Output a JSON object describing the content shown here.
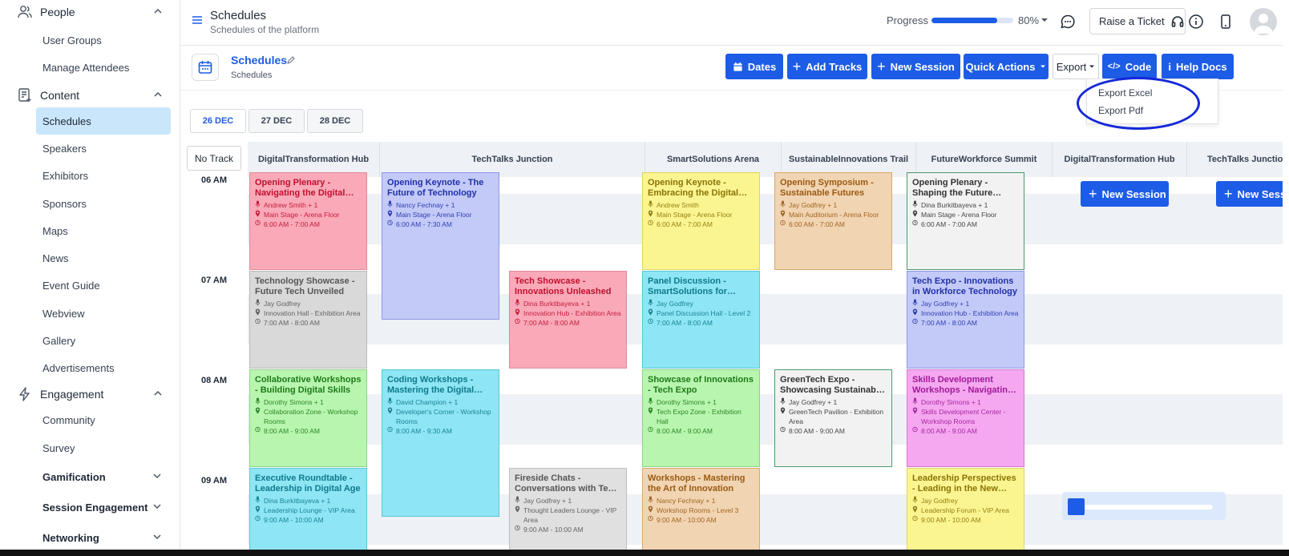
{
  "sidebar": {
    "groups": {
      "people": "People",
      "content": "Content",
      "engagement": "Engagement"
    },
    "people_items": [
      "User Groups",
      "Manage Attendees"
    ],
    "content_items": [
      "Schedules",
      "Speakers",
      "Exhibitors",
      "Sponsors",
      "Maps",
      "News",
      "Event Guide",
      "Webview",
      "Gallery",
      "Advertisements"
    ],
    "engagement_items": [
      "Community",
      "Survey"
    ],
    "subgroups": [
      "Gamification",
      "Session Engagement",
      "Networking"
    ]
  },
  "header": {
    "title": "Schedules",
    "subtitle": "Schedules of the platform",
    "progress_label": "Progress",
    "progress_value": 80,
    "progress_text": "80%",
    "ticket_label": "Raise a Ticket"
  },
  "page": {
    "title": "Schedules",
    "subtitle": "Schedules",
    "buttons": {
      "dates": "Dates",
      "add_tracks": "Add Tracks",
      "new_session": "New Session",
      "quick_actions": "Quick Actions",
      "export": "Export",
      "code": "Code",
      "help_docs": "Help Docs"
    },
    "export_menu": [
      "Export Excel",
      "Export Pdf"
    ]
  },
  "dates": [
    "26 DEC",
    "27 DEC",
    "28 DEC"
  ],
  "grid": {
    "no_track": "No Track",
    "tracks": [
      "DigitalTransformation Hub",
      "TechTalks Junction",
      "SmartSolutions Arena",
      "SustainableInnovations Trail",
      "FutureWorkforce Summit",
      "DigitalTransformation Hub",
      "TechTalks Junction"
    ],
    "times": [
      "06 AM",
      "07 AM",
      "08 AM",
      "09 AM"
    ],
    "new_session": "New Session",
    "sessions": [
      {
        "title": "Opening Plenary - Navigating the Digital Frontier",
        "speaker": "Andrew Smith + 1",
        "location": "Main Stage - Arena Floor",
        "time": "6:00 AM - 7:00 AM"
      },
      {
        "title": "Opening Keynote - The Future of Technology",
        "speaker": "Nancy Fechnay + 1",
        "location": "Main Stage - Arena Floor",
        "time": "6:00 AM - 7:30 AM"
      },
      {
        "title": "Opening Keynote - Embracing the Digital Future",
        "speaker": "Andrew Smith",
        "location": "Main Stage - Arena Floor",
        "time": "6:00 AM - 7:00 AM"
      },
      {
        "title": "Opening Symposium - Sustainable Futures",
        "speaker": "Jay Godfrey + 1",
        "location": "Main Auditorium - Arena Floor",
        "time": "6:00 AM - 7:00 AM"
      },
      {
        "title": "Opening Plenary - Shaping the Future Workforce",
        "speaker": "Dina Burkitbayeva + 1",
        "location": "Main Stage - Arena Floor",
        "time": "6:00 AM - 7:00 AM"
      },
      {
        "title": "Technology Showcase - Future Tech Unveiled",
        "speaker": "Jay Godfrey",
        "location": "Innovation Hall - Exhibition Area",
        "time": "7:00 AM - 8:00 AM"
      },
      {
        "title": "Tech Showcase - Innovations Unleashed",
        "speaker": "Dina Burkitbayeva + 1",
        "location": "Innovation Hub - Exhibition Area",
        "time": "7:00 AM - 8:00 AM"
      },
      {
        "title": "Panel Discussion - SmartSolutions for Tomorrow",
        "speaker": "Jay Godfrey",
        "location": "Panel Discussion Hall - Level 2",
        "time": "7:00 AM - 8:00 AM"
      },
      {
        "title": "Tech Expo - Innovations in Workforce Technology",
        "speaker": "Jay Godfrey + 1",
        "location": "Innovation Hub - Exhibition Area",
        "time": "7:00 AM - 8:00 AM"
      },
      {
        "title": "Collaborative Workshops - Building Digital Skills",
        "speaker": "Dorothy Simons + 1",
        "location": "Collaboration Zone - Workshop Rooms",
        "time": "8:00 AM - 9:00 AM"
      },
      {
        "title": "Coding Workshops - Mastering the Digital Craft",
        "speaker": "David Champion + 1",
        "location": "Developer's Corner - Workshop Rooms",
        "time": "8:00 AM - 9:30 AM"
      },
      {
        "title": "Showcase of Innovations - Tech Expo",
        "speaker": "Dorothy Simons + 1",
        "location": "Tech Expo Zone - Exhibition Hall",
        "time": "8:00 AM - 9:00 AM"
      },
      {
        "title": "GreenTech Expo - Showcasing Sustainable Tech",
        "speaker": "Jay Godfrey + 1",
        "location": "GreenTech Pavilion - Exhibition Area",
        "time": "8:00 AM - 9:00 AM"
      },
      {
        "title": "Skills Development Workshops - Navigating the Future",
        "speaker": "Dorothy Simons + 1",
        "location": "Skills Development Center - Workshop Rooms",
        "time": "8:00 AM - 9:00 AM"
      },
      {
        "title": "Executive Roundtable - Leadership in Digital Age",
        "speaker": "Dina Burkitbayeva + 1",
        "location": "Leadership Lounge - VIP Area",
        "time": "9:00 AM - 10:00 AM"
      },
      {
        "title": "Fireside Chats - Conversations with Tech Leaders",
        "speaker": "Jay Godfrey + 1",
        "location": "Thought Leaders Lounge - VIP Area",
        "time": "9:00 AM - 10:00 AM"
      },
      {
        "title": "Workshops - Mastering the Art of Innovation",
        "speaker": "Nancy Fechnay + 1",
        "location": "Workshop Rooms - Level 3",
        "time": "9:00 AM - 10:00 AM"
      },
      {
        "title": "Leadership Perspectives - Leading in the New Work Era",
        "speaker": "Jay Godfrey",
        "location": "Leadership Forum - VIP Area",
        "time": "9:00 AM - 10:00 AM"
      }
    ]
  },
  "colors": {
    "primary": "#1d5ce6",
    "highlight": "#1428d9"
  }
}
